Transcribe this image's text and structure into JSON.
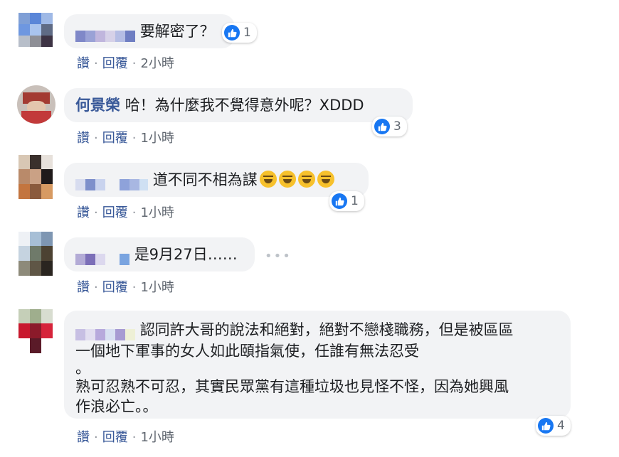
{
  "comments": [
    {
      "author": "",
      "text": "要解密了？",
      "reaction_count": "1",
      "actions": {
        "like": "讚",
        "reply": "回覆",
        "time": "2小時"
      }
    },
    {
      "author": "何景榮",
      "text": "哈！為什麼我不覺得意外呢？XDDD",
      "reaction_count": "3",
      "actions": {
        "like": "讚",
        "reply": "回覆",
        "time": "1小時"
      }
    },
    {
      "author": "",
      "text": "道不同不相為謀",
      "reaction_count": "1",
      "emoji": [
        "rolling-on-floor-laughing",
        "rolling-on-floor-laughing",
        "rolling-on-floor-laughing",
        "rolling-on-floor-laughing"
      ],
      "actions": {
        "like": "讚",
        "reply": "回覆",
        "time": "1小時"
      }
    },
    {
      "author": "",
      "text": "是9月27日……",
      "more": "•••",
      "actions": {
        "like": "讚",
        "reply": "回覆",
        "time": "1小時"
      }
    },
    {
      "author": "",
      "text_lines": [
        "認同許大哥的說法和絕對，絕對不戀棧職務，但是被區區",
        "一個地下軍事的女人如此頤指氣使，任誰有無法忍受",
        "。",
        "熟可忍熟不可忍，其實民眾黨有這種垃圾也見怪不怪，因為她興風",
        "作浪必亡。。"
      ],
      "reaction_count": "4",
      "actions": {
        "like": "讚",
        "reply": "回覆",
        "time": "1小時"
      }
    }
  ],
  "colors": {
    "bubble": "#f2f3f5",
    "link": "#385898",
    "meta": "#606770",
    "like": "#1877f2"
  }
}
